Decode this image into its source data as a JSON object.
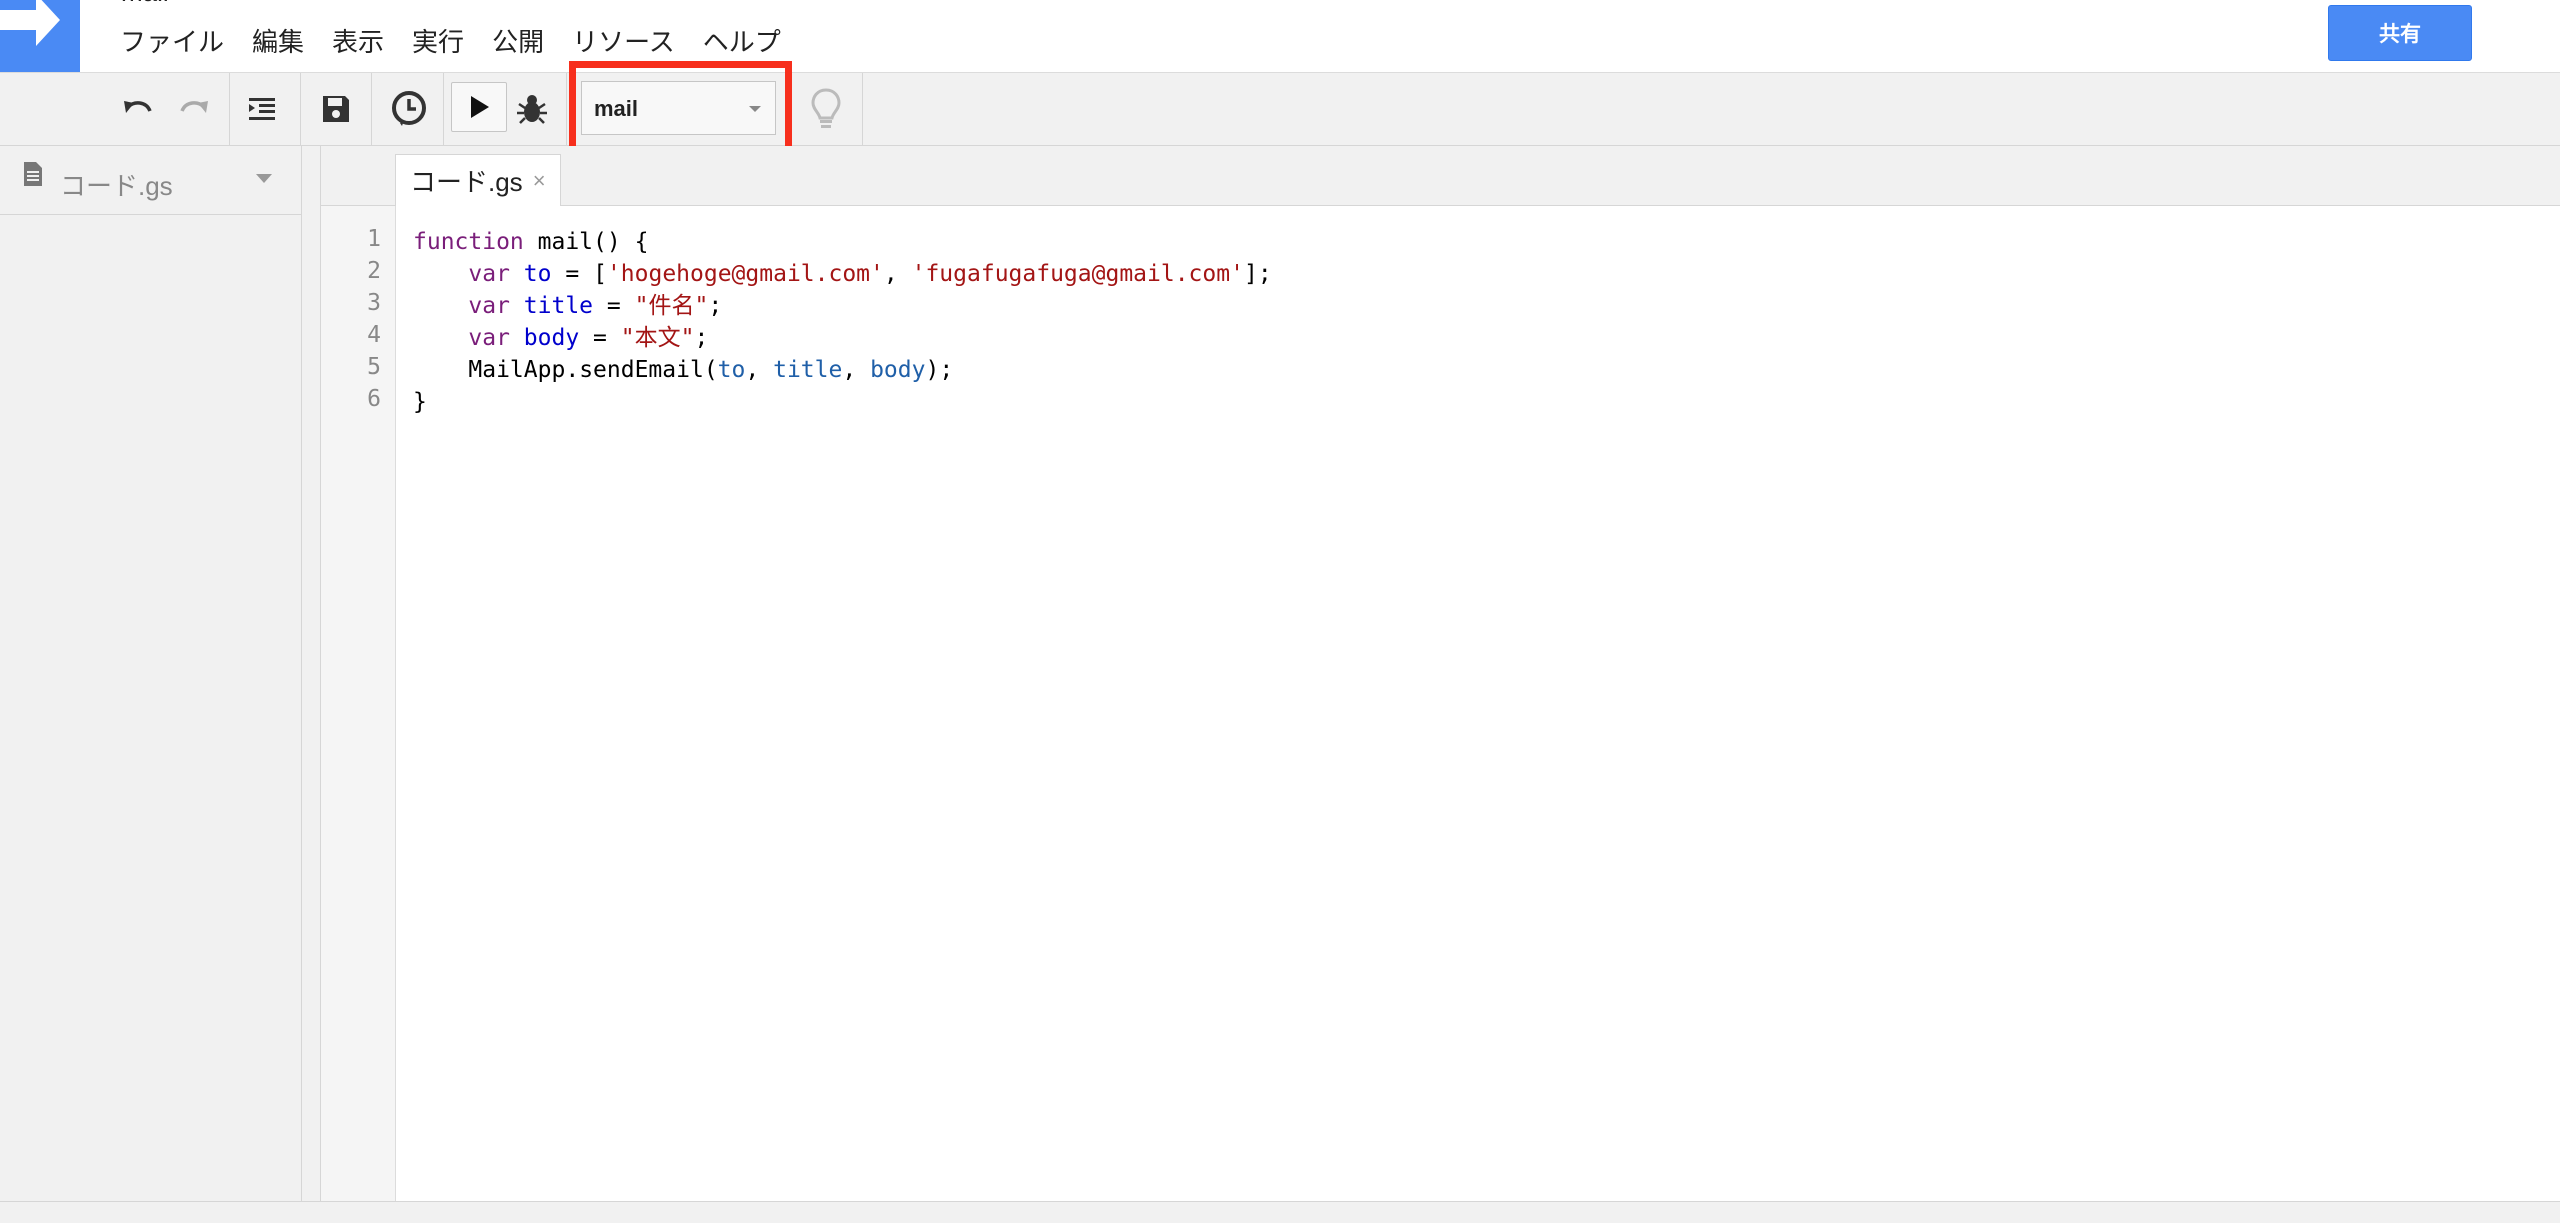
{
  "app": {
    "title": "mail",
    "logo_icon": "apps-script-arrow-icon",
    "accent_color": "#4a8af4"
  },
  "menubar": {
    "items": [
      "ファイル",
      "編集",
      "表示",
      "実行",
      "公開",
      "リソース",
      "ヘルプ"
    ]
  },
  "share_button": {
    "label": "共有"
  },
  "toolbar": {
    "icons": [
      "undo-icon",
      "redo-icon",
      "indent-icon",
      "save-icon",
      "clock-trigger-icon",
      "run-icon",
      "debug-bug-icon",
      "lightbulb-icon"
    ],
    "function_select": {
      "value": "mail"
    },
    "highlight_color": "#f72f1d"
  },
  "sidebar": {
    "files": [
      {
        "name": "コード.gs",
        "icon": "document-icon"
      }
    ]
  },
  "tabs": [
    {
      "label": "コード.gs",
      "close": "×"
    }
  ],
  "editor": {
    "line_numbers": [
      "1",
      "2",
      "3",
      "4",
      "5",
      "6"
    ],
    "code": [
      "function mail() {",
      "    var to = ['hogehoge@gmail.com', 'fugafugafuga@gmail.com'];",
      "    var title = \"件名\";",
      "    var body = \"本文\";",
      "    MailApp.sendEmail(to, title, body);",
      "}"
    ]
  }
}
